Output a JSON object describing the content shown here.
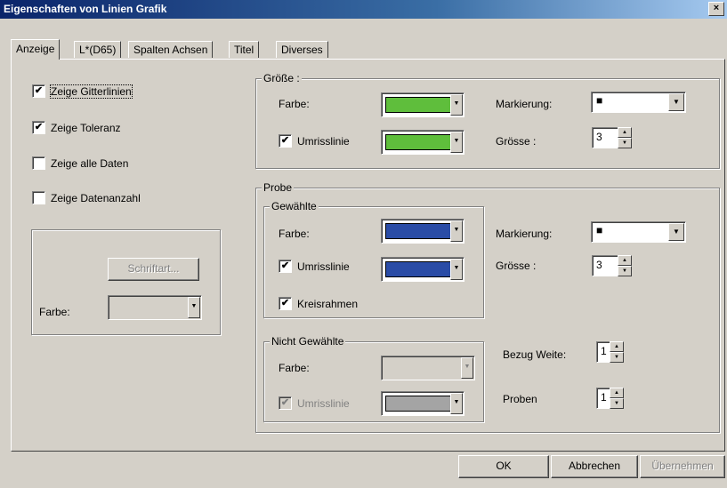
{
  "window": {
    "title": "Eigenschaften von Linien Grafik",
    "close_label": "×"
  },
  "tabs": [
    "Anzeige",
    "L*(D65)",
    "Spalten Achsen",
    "Titel",
    "Diverses"
  ],
  "left": {
    "checkboxes": [
      {
        "label": "Zeige Gitterlinien",
        "checked": true
      },
      {
        "label": "Zeige Toleranz",
        "checked": true
      },
      {
        "label": "Zeige alle Daten",
        "checked": false
      },
      {
        "label": "Zeige Datenanzahl",
        "checked": false
      }
    ],
    "font_button": "Schriftart...",
    "color_label": "Farbe:"
  },
  "groesse": {
    "title": "Größe :",
    "farbe_label": "Farbe:",
    "farbe_color": "#5fbe3c",
    "umriss_label": "Umrisslinie",
    "umriss_color": "#5fbe3c",
    "markierung_label": "Markierung:",
    "markierung_value": "■",
    "groesse_label": "Grösse :",
    "groesse_value": "3"
  },
  "probe": {
    "title": "Probe",
    "gewaehlte": {
      "title": "Gewählte",
      "farbe_label": "Farbe:",
      "farbe_color": "#2a4ca6",
      "umriss_label": "Umrisslinie",
      "umriss_color": "#2a4ca6",
      "kreis_label": "Kreisrahmen"
    },
    "markierung_label": "Markierung:",
    "markierung_value": "■",
    "groesse_label": "Grösse :",
    "groesse_value": "3",
    "nicht_gewaehlte": {
      "title": "Nicht Gewählte",
      "farbe_label": "Farbe:",
      "umriss_label": "Umrisslinie",
      "umriss_color": "#a4a4a4"
    },
    "bezug_label": "Bezug Weite:",
    "bezug_value": "1",
    "proben_label": "Proben",
    "proben_value": "1"
  },
  "buttons": {
    "ok": "OK",
    "cancel": "Abbrechen",
    "apply": "Übernehmen"
  },
  "glyphs": {
    "check": "✔",
    "down": "▼",
    "up": "▲"
  }
}
